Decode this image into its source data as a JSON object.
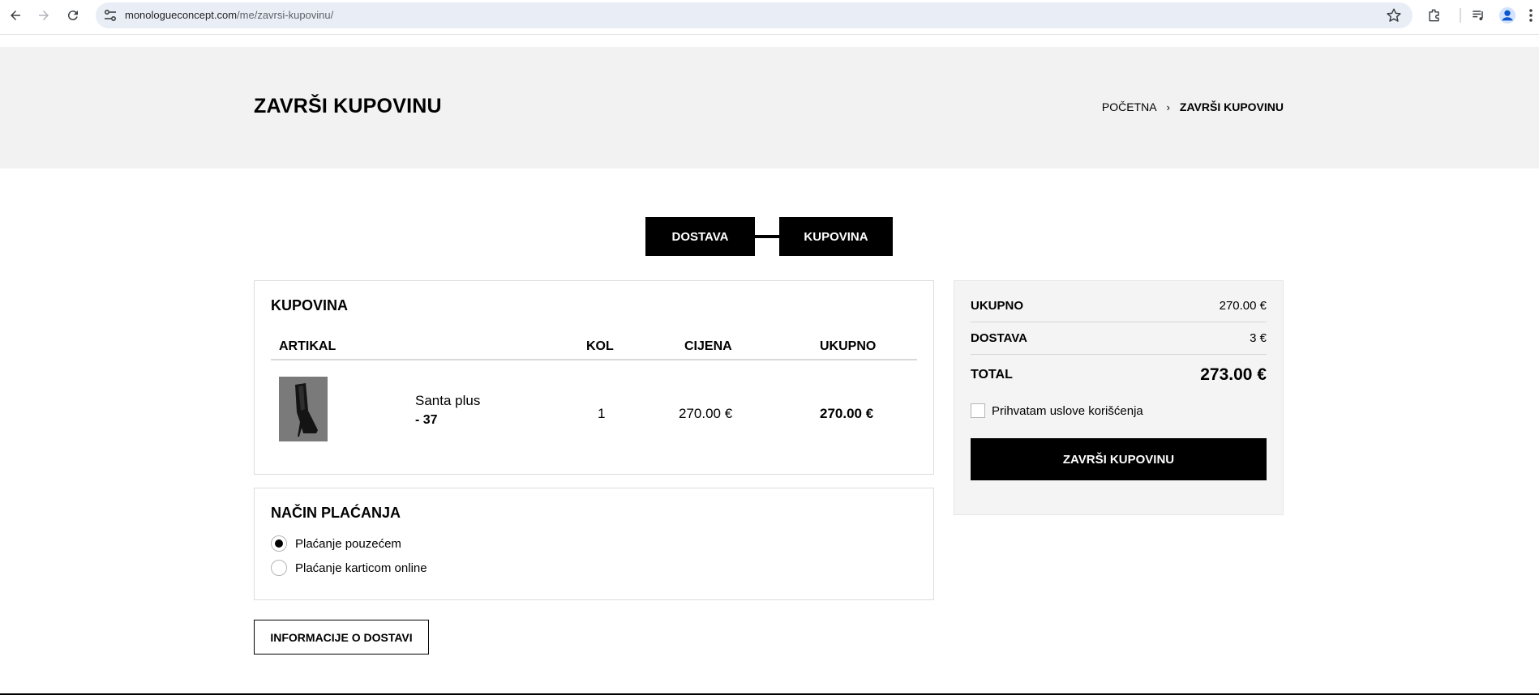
{
  "browser": {
    "url_host": "monologueconcept.com",
    "url_path": "/me/zavrsi-kupovinu/"
  },
  "header": {
    "title": "ZAVRŠI KUPOVINU",
    "breadcrumb_home": "POČETNA",
    "breadcrumb_sep": "›",
    "breadcrumb_current": "ZAVRŠI KUPOVINU"
  },
  "steps": [
    {
      "label": "DOSTAVA"
    },
    {
      "label": "KUPOVINA"
    }
  ],
  "order": {
    "title": "KUPOVINA",
    "columns": {
      "item": "ARTIKAL",
      "qty": "KOL",
      "price": "CIJENA",
      "total": "UKUPNO"
    },
    "items": [
      {
        "name": "Santa plus",
        "size": "- 37",
        "qty": "1",
        "price": "270.00 €",
        "total": "270.00 €"
      }
    ]
  },
  "payment": {
    "title": "NAČIN PLAĆANJA",
    "options": [
      {
        "label": "Plaćanje pouzećem",
        "selected": true
      },
      {
        "label": "Plaćanje karticom online",
        "selected": false
      }
    ]
  },
  "info_button": "INFORMACIJE O DOSTAVI",
  "summary": {
    "subtotal_label": "UKUPNO",
    "subtotal_value": "270.00 €",
    "shipping_label": "DOSTAVA",
    "shipping_value": "3 €",
    "total_label": "TOTAL",
    "total_value": "273.00 €",
    "terms_label": "Prihvatam uslove korišćenja",
    "finish_button": "ZAVRŠI KUPOVINU"
  },
  "icons": {
    "back": "arrow-left-icon",
    "forward": "arrow-right-icon",
    "reload": "reload-icon",
    "site_info": "tune-icon",
    "bookmark": "star-icon",
    "extensions": "puzzle-icon",
    "media": "playlist-icon",
    "profile": "avatar-icon",
    "menu": "kebab-menu-icon"
  }
}
